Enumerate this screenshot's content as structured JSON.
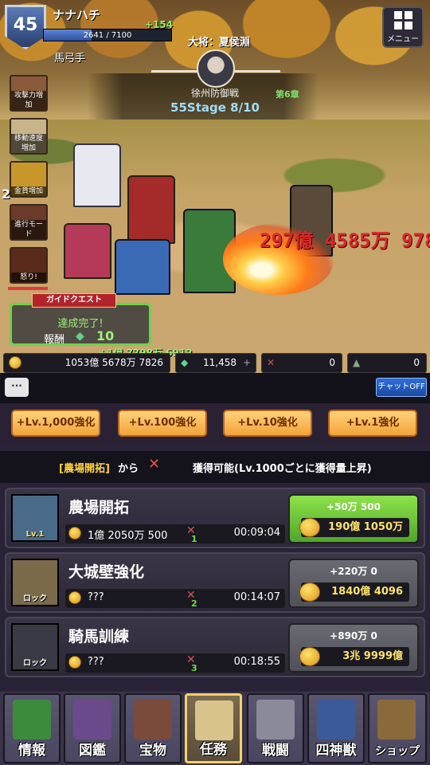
{
  "player": {
    "level": "45",
    "name": "ナナハチ",
    "exp_text": "2641 / 7100",
    "exp_fraction": 0.372,
    "exp_gain": "+154",
    "unit_type": "馬弓手"
  },
  "menu": {
    "label": "メニュー"
  },
  "stage": {
    "general": "大将：夏侯淵",
    "name": "徐州防御戦",
    "chapter": "第6章",
    "progress": "55Stage  8/10"
  },
  "skills": [
    {
      "label": "攻撃力増加",
      "color": "#8a5a3a"
    },
    {
      "label": "移動速度増加",
      "color": "#c9b48a"
    },
    {
      "label": "金貨増加",
      "color": "#c8962a"
    },
    {
      "label": "進行モード",
      "color": "#6a3a2a"
    },
    {
      "label": "怒り!",
      "color": "#5a2a1a"
    }
  ],
  "skill_count": "2",
  "battle": {
    "damage": "297億 4585万 978"
  },
  "quest": {
    "title": "ガイドクエスト",
    "status": "達成完了!",
    "reward_label": "報酬",
    "reward_value": "10"
  },
  "gold_popup": "+1億 7798万 6912",
  "resources": {
    "gold": "1053億 5678万 7826",
    "gems": "11,458",
    "axes": "0",
    "helmets": "0"
  },
  "chat": {
    "off_label": "チャットOFF"
  },
  "multipliers": [
    "+Lv.1,000強化",
    "+Lv.100強化",
    "+Lv.10強化",
    "+Lv.1強化"
  ],
  "info_banner": {
    "left": "[農場開拓]",
    "mid": "から",
    "right": "獲得可能(Lv.1000ごとに獲得量上昇)"
  },
  "tasks": [
    {
      "name": "農場開拓",
      "badge": "Lv.1",
      "amount": "1億 2050万 500",
      "axes": "1",
      "time": "00:09:04",
      "gain": "+50万 500",
      "cost": "190億 1050万",
      "state": "on",
      "thumb": "#4a6a8a"
    },
    {
      "name": "大城壁強化",
      "badge": "ロック",
      "amount": "???",
      "axes": "2",
      "time": "00:14:07",
      "gain": "+220万 0",
      "cost": "1840億 4096",
      "state": "off",
      "thumb": "#7a6a4a"
    },
    {
      "name": "騎馬訓練",
      "badge": "ロック",
      "amount": "???",
      "axes": "3",
      "time": "00:18:55",
      "gain": "+890万 0",
      "cost": "3兆 9999億",
      "state": "off",
      "thumb": "#3a3a44"
    }
  ],
  "nav": [
    {
      "label": "情報",
      "active": false,
      "color": "#3c8a3c"
    },
    {
      "label": "図鑑",
      "active": false,
      "color": "#6a4a8a"
    },
    {
      "label": "宝物",
      "active": false,
      "color": "#7a4a3a"
    },
    {
      "label": "任務",
      "active": true,
      "color": "#d8c48a"
    },
    {
      "label": "戦闘",
      "active": false,
      "color": "#8a8a9a"
    },
    {
      "label": "四神獣",
      "active": false,
      "color": "#3a5a9a"
    },
    {
      "label": "ショップ",
      "active": false,
      "color": "#8a6a3a"
    }
  ]
}
